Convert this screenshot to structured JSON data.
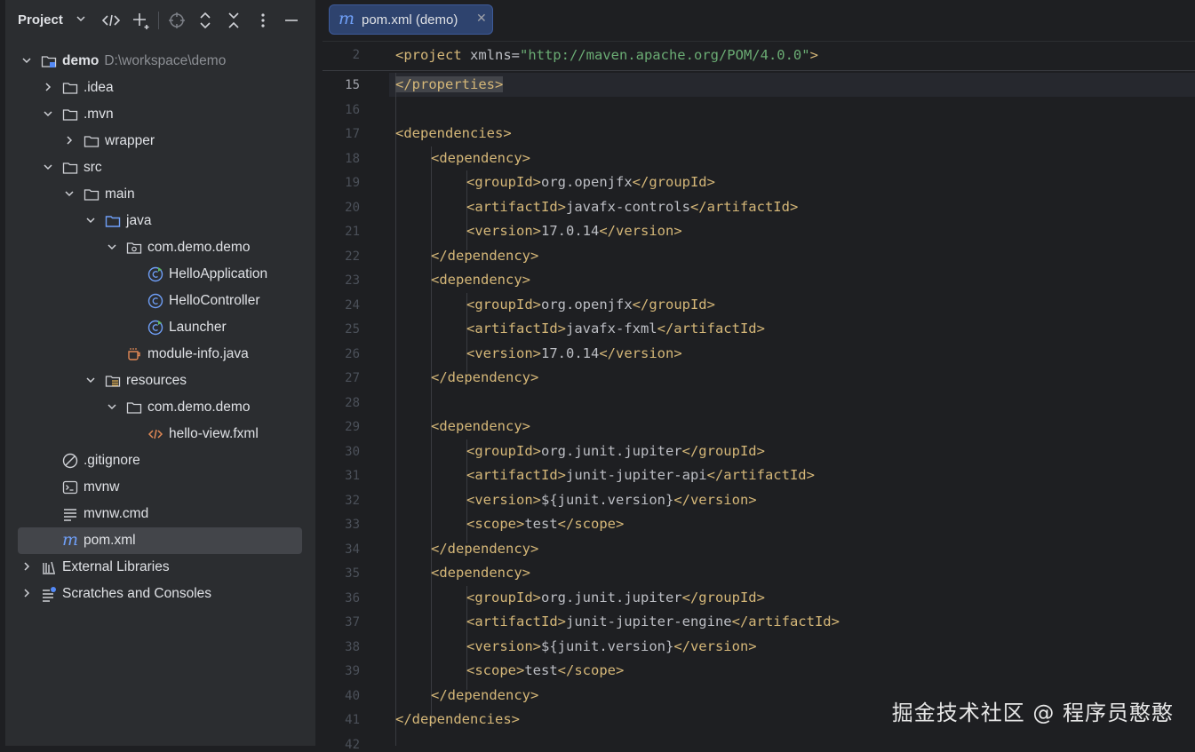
{
  "project_panel": {
    "title": "Project",
    "tree": [
      {
        "label": "demo",
        "path": "D:\\workspace\\demo"
      },
      {
        "label": ".idea"
      },
      {
        "label": ".mvn"
      },
      {
        "label": "wrapper"
      },
      {
        "label": "src"
      },
      {
        "label": "main"
      },
      {
        "label": "java"
      },
      {
        "label": "com.demo.demo"
      },
      {
        "label": "HelloApplication"
      },
      {
        "label": "HelloController"
      },
      {
        "label": "Launcher"
      },
      {
        "label": "module-info.java"
      },
      {
        "label": "resources"
      },
      {
        "label": "com.demo.demo"
      },
      {
        "label": "hello-view.fxml"
      },
      {
        "label": ".gitignore"
      },
      {
        "label": "mvnw"
      },
      {
        "label": "mvnw.cmd"
      },
      {
        "label": "pom.xml"
      },
      {
        "label": "External Libraries"
      },
      {
        "label": "Scratches and Consoles"
      }
    ]
  },
  "editor": {
    "tab": {
      "icon_text": "m",
      "label": "pom.xml (demo)",
      "close": "✕"
    },
    "sticky": {
      "line": "2",
      "tag_open": "<project",
      "attr": " xmlns=",
      "value": "\"http://maven.apache.org/POM/4.0.0\""
    },
    "line_numbers": [
      "15",
      "16",
      "17",
      "18",
      "19",
      "20",
      "21",
      "22",
      "23",
      "24",
      "25",
      "26",
      "27",
      "28",
      "29",
      "30",
      "31",
      "32",
      "33",
      "34",
      "35",
      "36",
      "37",
      "38",
      "39",
      "40",
      "41",
      "42"
    ],
    "lines": {
      "l15": "</properties>",
      "l17": "<dependencies>",
      "l18": "<dependency>",
      "l19a": "<groupId>",
      "l19b": "org.openjfx",
      "l19c": "</groupId>",
      "l20a": "<artifactId>",
      "l20b": "javafx-controls",
      "l20c": "</artifactId>",
      "l21a": "<version>",
      "l21b": "17.0.14",
      "l21c": "</version>",
      "l22": "</dependency>",
      "l23": "<dependency>",
      "l24a": "<groupId>",
      "l24b": "org.openjfx",
      "l24c": "</groupId>",
      "l25a": "<artifactId>",
      "l25b": "javafx-fxml",
      "l25c": "</artifactId>",
      "l26a": "<version>",
      "l26b": "17.0.14",
      "l26c": "</version>",
      "l27": "</dependency>",
      "l29": "<dependency>",
      "l30a": "<groupId>",
      "l30b": "org.junit.jupiter",
      "l30c": "</groupId>",
      "l31a": "<artifactId>",
      "l31b": "junit-jupiter-api",
      "l31c": "</artifactId>",
      "l32a": "<version>",
      "l32b": "${junit.version}",
      "l32c": "</version>",
      "l33a": "<scope>",
      "l33b": "test",
      "l33c": "</scope>",
      "l34": "</dependency>",
      "l35": "<dependency>",
      "l36a": "<groupId>",
      "l36b": "org.junit.jupiter",
      "l36c": "</groupId>",
      "l37a": "<artifactId>",
      "l37b": "junit-jupiter-engine",
      "l37c": "</artifactId>",
      "l38a": "<version>",
      "l38b": "${junit.version}",
      "l38c": "</version>",
      "l39a": "<scope>",
      "l39b": "test",
      "l39c": "</scope>",
      "l40": "</dependency>",
      "l41": "</dependencies>"
    }
  },
  "watermark": "掘金技术社区 @ 程序员憨憨",
  "colors": {
    "tag": "#d5b778",
    "string": "#6aab73",
    "accent": "#3d5a99",
    "selection": "#43454a"
  }
}
